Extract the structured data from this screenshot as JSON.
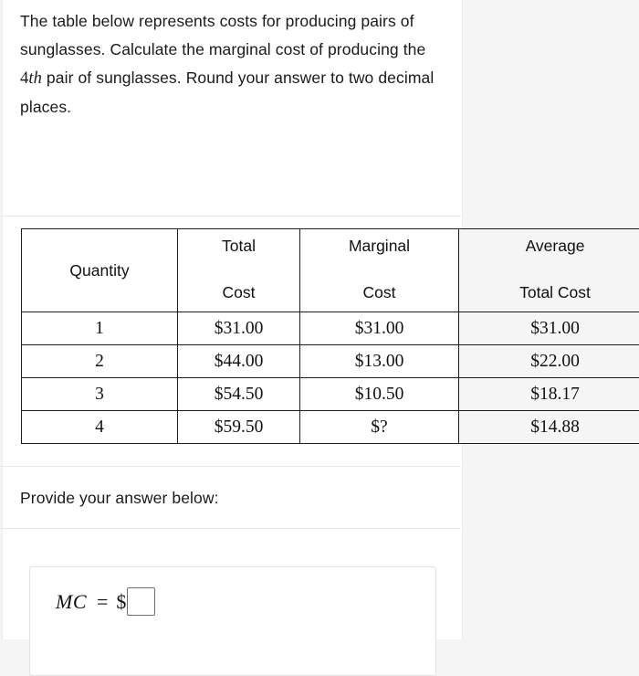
{
  "colors": {
    "page_background": "#ffffff",
    "outer_background": "#f5f5f5",
    "table_border": "#1c1c1c",
    "divider": "#e8e8e8",
    "text": "#1a1a1a",
    "input_border": "#6e6e6e",
    "panel_border": "#e3e3e3"
  },
  "question": {
    "part1": "The table below represents costs for producing pairs of sunglasses. Calculate the marginal cost of producing the ",
    "ordinal_number": "4",
    "ordinal_suffix": "th",
    "part2": " pair of sunglasses. Round your answer to two decimal places."
  },
  "table": {
    "headers": [
      {
        "line1": "",
        "line2": "",
        "single": "Quantity"
      },
      {
        "line1": "Total",
        "line2": "Cost",
        "single": ""
      },
      {
        "line1": "Marginal",
        "line2": "Cost",
        "single": ""
      },
      {
        "line1": "Average",
        "line2": "Total Cost",
        "single": ""
      }
    ],
    "rows": [
      {
        "quantity": "1",
        "total_cost": "$31.00",
        "marginal_cost": "$31.00",
        "average_total_cost": "$31.00"
      },
      {
        "quantity": "2",
        "total_cost": "$44.00",
        "marginal_cost": "$13.00",
        "average_total_cost": "$22.00"
      },
      {
        "quantity": "3",
        "total_cost": "$54.50",
        "marginal_cost": "$10.50",
        "average_total_cost": "$18.17"
      },
      {
        "quantity": "4",
        "total_cost": "$59.50",
        "marginal_cost": "$?",
        "average_total_cost": "$14.88"
      }
    ]
  },
  "answer_section": {
    "label": "Provide your answer below:",
    "expression_variable": "MC",
    "expression_equals": "=",
    "expression_currency": "$",
    "input_value": "",
    "input_placeholder": ""
  },
  "chart_data": {
    "type": "table",
    "title": "Costs for producing pairs of sunglasses",
    "columns": [
      "Quantity",
      "Total Cost",
      "Marginal Cost",
      "Average Total Cost"
    ],
    "rows": [
      [
        "1",
        "$31.00",
        "$31.00",
        "$31.00"
      ],
      [
        "2",
        "$44.00",
        "$13.00",
        "$22.00"
      ],
      [
        "3",
        "$54.50",
        "$10.50",
        "$18.17"
      ],
      [
        "4",
        "$59.50",
        "$?",
        "$14.88"
      ]
    ],
    "quantity": [
      1,
      2,
      3,
      4
    ],
    "total_cost": [
      31.0,
      44.0,
      54.5,
      59.5
    ],
    "marginal_cost": [
      31.0,
      13.0,
      10.5,
      null
    ],
    "average_total_cost": [
      31.0,
      22.0,
      18.17,
      14.88
    ],
    "unknown_cell": {
      "row": 4,
      "column": "Marginal Cost",
      "displayed": "$?"
    }
  }
}
